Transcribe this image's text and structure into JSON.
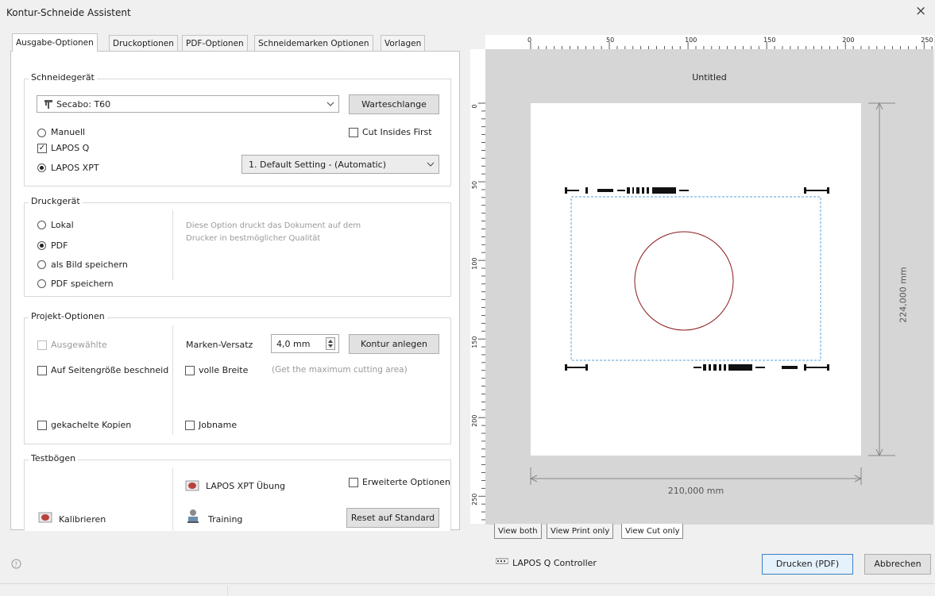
{
  "window": {
    "title": "Kontur-Schneide Assistent",
    "close": "×"
  },
  "tabs": [
    {
      "label": "Ausgabe-Optionen"
    },
    {
      "label": "Druckoptionen"
    },
    {
      "label": "PDF-Optionen"
    },
    {
      "label": "Schneidemarken Optionen"
    },
    {
      "label": "Vorlagen"
    }
  ],
  "schneidegeraet": {
    "title": "Schneidegerät",
    "device": "Secabo: T60",
    "queue_button": "Warteschlange",
    "options": [
      {
        "label": "Manuell",
        "type": "radio",
        "selected": false
      },
      {
        "label": "LAPOS Q",
        "type": "checkbox",
        "checked": true
      },
      {
        "label": "LAPOS XPT",
        "type": "radio",
        "selected": true
      }
    ],
    "cut_insides_first": "Cut Insides First",
    "setting": "1. Default Setting - (Automatic)"
  },
  "druckgeraet": {
    "title": "Druckgerät",
    "options": [
      {
        "label": "Lokal",
        "selected": false
      },
      {
        "label": "PDF",
        "selected": true
      },
      {
        "label": "als Bild speichern",
        "selected": false
      },
      {
        "label": "PDF speichern",
        "selected": false
      }
    ],
    "description_line1": "Diese Option druckt das Dokument auf dem",
    "description_line2": "Drucker in bestmöglicher Qualität"
  },
  "projekt": {
    "title": "Projekt-Optionen",
    "ausgewaehlte": "Ausgewählte",
    "seitengroesse": "Auf Seitengröße beschneid",
    "gekachelte": "gekachelte Kopien",
    "marken_label": "Marken-Versatz",
    "marken_value": "4,0 mm",
    "kontur_button": "Kontur anlegen",
    "volle_breite": "volle Breite",
    "volle_hint": "(Get the maximum cutting area)",
    "jobname": "Jobname"
  },
  "testboegen": {
    "title": "Testbögen",
    "kalibrieren": "Kalibrieren",
    "xpt_uebung": "LAPOS XPT Übung",
    "training": "Training",
    "erweiterte": "Erweiterte Optionen",
    "reset_button": "Reset auf Standard"
  },
  "preview": {
    "doc_title": "Untitled",
    "ruler_h": [
      "0",
      "50",
      "100",
      "150",
      "200",
      "250"
    ],
    "ruler_v": [
      "0",
      "50",
      "100",
      "150",
      "200",
      "250"
    ],
    "height_dim": "224,000 mm",
    "width_dim": "210,000 mm",
    "view_tabs": [
      "View both",
      "View Print only",
      "View Cut only"
    ]
  },
  "footer": {
    "help_icon": "question-icon",
    "controller": "LAPOS Q Controller",
    "print_button": "Drucken (PDF)",
    "cancel_button": "Abbrechen"
  },
  "colors": {
    "circle": "#8b1a1a",
    "cut_frame": "#5aa0d8",
    "dimension": "#888888"
  }
}
